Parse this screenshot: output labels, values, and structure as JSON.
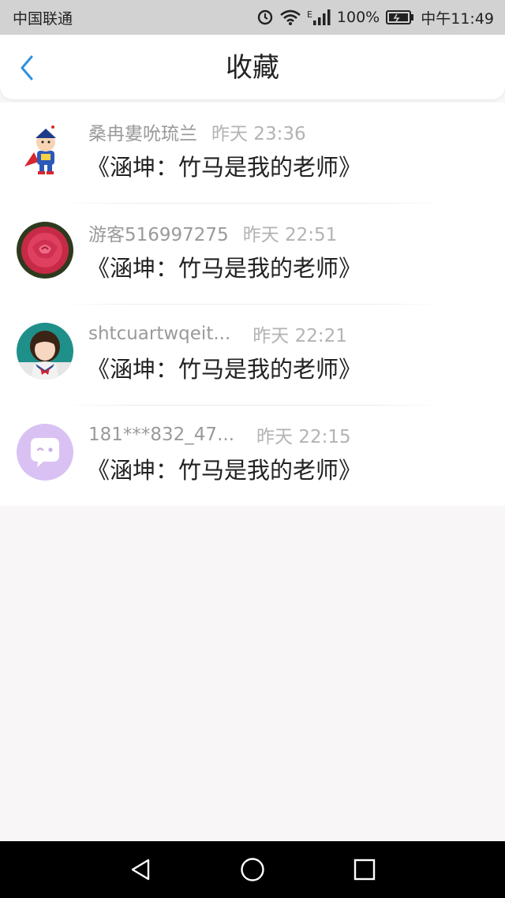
{
  "status_bar": {
    "carrier": "中国联通",
    "battery": "100%",
    "time": "中午11:49",
    "signal_label": "E"
  },
  "header": {
    "title": "收藏"
  },
  "favorites": [
    {
      "user": "桑冉婁吮琉兰",
      "time": "昨天 23:36",
      "content": "《涵坤：竹马是我的老师》",
      "avatar": "superman-cartoon-avatar"
    },
    {
      "user": "游客516997275",
      "time": "昨天 22:51",
      "content": "《涵坤：竹马是我的老师》",
      "avatar": "rose-avatar"
    },
    {
      "user": "shtcuartwqeit...",
      "time": "昨天 22:21",
      "content": "《涵坤：竹马是我的老师》",
      "avatar": "girl-photo-avatar"
    },
    {
      "user": "181***832_47...",
      "time": "昨天 22:15",
      "content": "《涵坤：竹马是我的老师》",
      "avatar": "default-chat-avatar"
    }
  ],
  "colors": {
    "accent": "#2f8fe0",
    "status_bar_bg": "#d2d2d2",
    "page_bg": "#f8f6f7",
    "default_avatar_bg": "#d9c2f3"
  }
}
